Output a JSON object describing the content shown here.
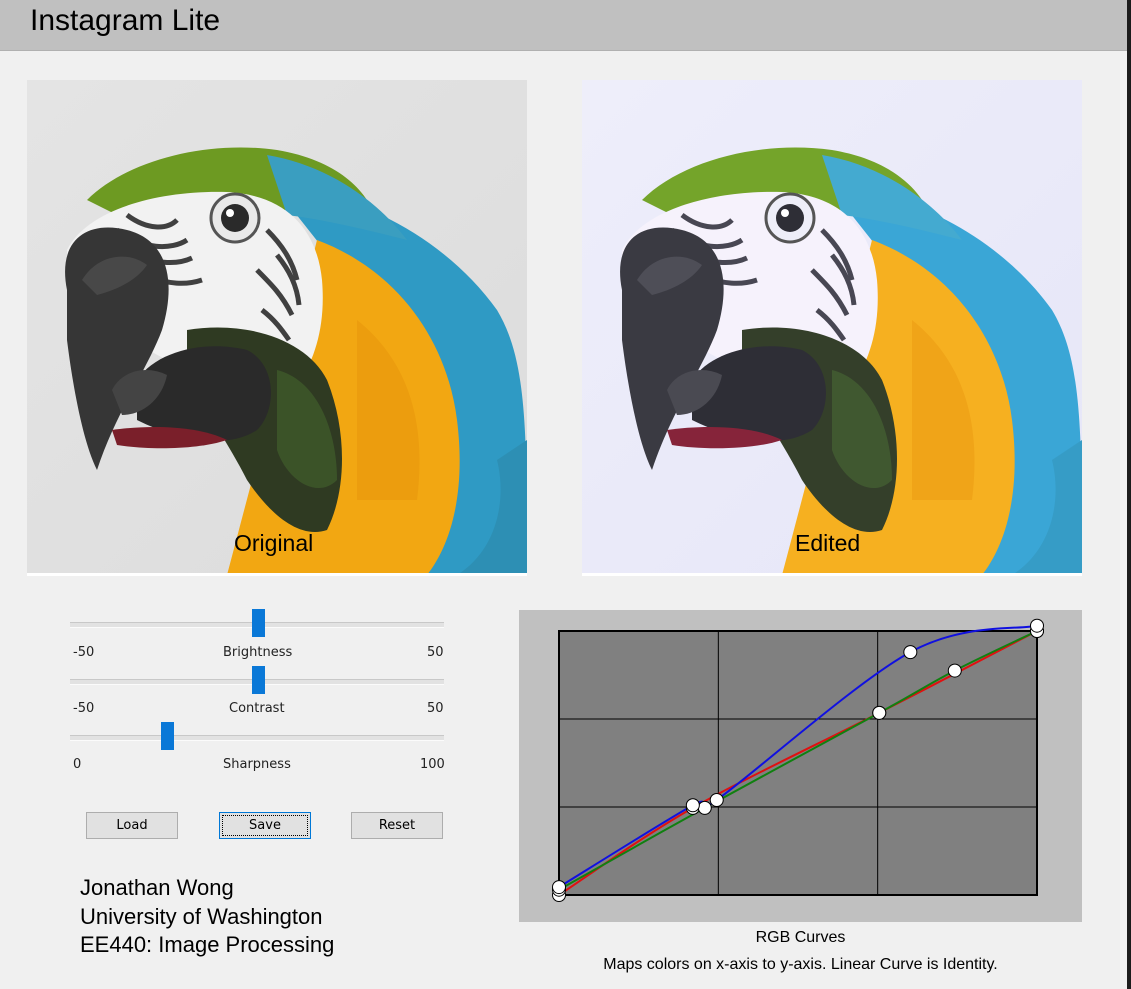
{
  "window": {
    "title": "Instagram Lite"
  },
  "images": {
    "original_caption": "Original",
    "edited_caption": "Edited"
  },
  "sliders": [
    {
      "name": "Brightness",
      "min_label": "-50",
      "max_label": "50",
      "min": -50,
      "max": 50,
      "value": 0
    },
    {
      "name": "Contrast",
      "min_label": "-50",
      "max_label": "50",
      "min": -50,
      "max": 50,
      "value": 0
    },
    {
      "name": "Sharpness",
      "min_label": "0",
      "max_label": "100",
      "min": 0,
      "max": 100,
      "value": 25
    }
  ],
  "buttons": {
    "load": "Load",
    "save": "Save",
    "reset": "Reset"
  },
  "credits": {
    "name": "Jonathan Wong",
    "school": "University of Washington",
    "course": "EE440: Image Processing"
  },
  "curves": {
    "title": "RGB Curves",
    "description": "Maps colors on x-axis to y-axis. Linear Curve is Identity.",
    "colors": {
      "red": "#e01010",
      "green": "#108010",
      "blue": "#1010e0",
      "background": "#808080",
      "panel": "#c0c0c0"
    },
    "red_points": [
      [
        0,
        0
      ],
      [
        0.28,
        0.33
      ],
      [
        0.67,
        0.69
      ],
      [
        1,
        1
      ]
    ],
    "green_points": [
      [
        0,
        0.02
      ],
      [
        0.305,
        0.33
      ],
      [
        0.67,
        0.69
      ],
      [
        0.828,
        0.85
      ],
      [
        1,
        1
      ]
    ],
    "blue_points": [
      [
        0,
        0.03
      ],
      [
        0.28,
        0.34
      ],
      [
        0.33,
        0.36
      ],
      [
        0.735,
        0.92
      ],
      [
        1,
        1.02
      ]
    ]
  }
}
